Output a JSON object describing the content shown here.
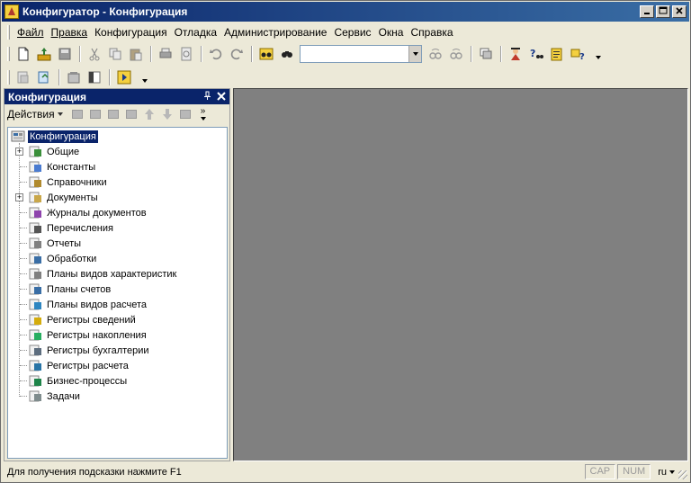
{
  "window": {
    "title": "Конфигуратор - Конфигурация",
    "minimize_icon": "minimize-icon",
    "maximize_icon": "maximize-icon",
    "close_icon": "close-icon"
  },
  "menu": [
    {
      "label": "Файл",
      "underline_first": true
    },
    {
      "label": "Правка",
      "underline_first": true
    },
    {
      "label": "Конфигурация",
      "underline_first": false
    },
    {
      "label": "Отладка",
      "underline_first": false
    },
    {
      "label": "Администрирование",
      "underline_first": false
    },
    {
      "label": "Сервис",
      "underline_first": false
    },
    {
      "label": "Окна",
      "underline_first": false
    },
    {
      "label": "Справка",
      "underline_first": false
    }
  ],
  "toolbar": {
    "search_value": "",
    "icons": [
      "new-file-icon",
      "open-icon",
      "save-icon",
      "cut-icon",
      "copy-icon",
      "paste-icon",
      "print-icon",
      "preview-icon",
      "undo-icon",
      "redo-icon",
      "find-icon",
      "find-next-icon",
      "search-combo-icon",
      "find-forward-icon",
      "find-back-icon",
      "window-icon",
      "wizard-icon",
      "help-icon",
      "syntax-icon",
      "about-icon"
    ]
  },
  "panel": {
    "title": "Конфигурация",
    "actions_label": "Действия",
    "pin_icon": "pin-icon",
    "close_icon": "close-icon"
  },
  "tree": {
    "root": "Конфигурация",
    "items": [
      {
        "label": "Общие",
        "expandable": true,
        "icon": "common-icon",
        "color": "#3a8f3a"
      },
      {
        "label": "Константы",
        "expandable": false,
        "icon": "constants-icon",
        "color": "#4a7bd0"
      },
      {
        "label": "Справочники",
        "expandable": false,
        "icon": "catalogs-icon",
        "color": "#b08a2e"
      },
      {
        "label": "Документы",
        "expandable": true,
        "icon": "documents-icon",
        "color": "#c9a74a"
      },
      {
        "label": "Журналы документов",
        "expandable": false,
        "icon": "journals-icon",
        "color": "#8e44ad"
      },
      {
        "label": "Перечисления",
        "expandable": false,
        "icon": "enums-icon",
        "color": "#555555"
      },
      {
        "label": "Отчеты",
        "expandable": false,
        "icon": "reports-icon",
        "color": "#808080"
      },
      {
        "label": "Обработки",
        "expandable": false,
        "icon": "processing-icon",
        "color": "#3a6ea5"
      },
      {
        "label": "Планы видов характеристик",
        "expandable": false,
        "icon": "chart-of-characteristics-icon",
        "color": "#808080"
      },
      {
        "label": "Планы счетов",
        "expandable": false,
        "icon": "chart-of-accounts-icon",
        "color": "#3a6ea5"
      },
      {
        "label": "Планы видов расчета",
        "expandable": false,
        "icon": "calculation-types-icon",
        "color": "#2e86c1"
      },
      {
        "label": "Регистры сведений",
        "expandable": false,
        "icon": "info-registers-icon",
        "color": "#d4ac0d"
      },
      {
        "label": "Регистры накопления",
        "expandable": false,
        "icon": "accumulation-registers-icon",
        "color": "#27ae60"
      },
      {
        "label": "Регистры бухгалтерии",
        "expandable": false,
        "icon": "accounting-registers-icon",
        "color": "#5d6d7e"
      },
      {
        "label": "Регистры расчета",
        "expandable": false,
        "icon": "calculation-registers-icon",
        "color": "#2874a6"
      },
      {
        "label": "Бизнес-процессы",
        "expandable": false,
        "icon": "business-processes-icon",
        "color": "#1e8449"
      },
      {
        "label": "Задачи",
        "expandable": false,
        "icon": "tasks-icon",
        "color": "#7f8c8d"
      }
    ]
  },
  "statusbar": {
    "hint": "Для получения подсказки нажмите F1",
    "cap": "CAP",
    "num": "NUM",
    "lang": "ru"
  }
}
